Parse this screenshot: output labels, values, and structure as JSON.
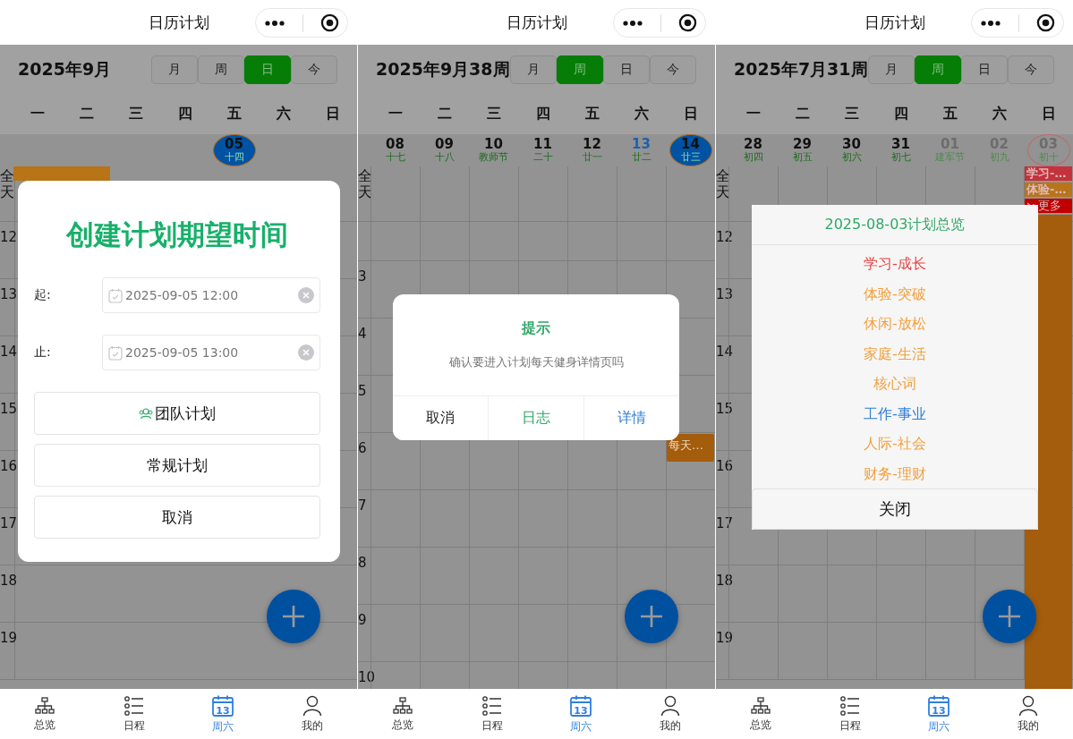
{
  "panels": [
    {
      "title": "日历计划",
      "heading": "2025年9月",
      "view_tabs": [
        {
          "label": "月",
          "selected": false
        },
        {
          "label": "周",
          "selected": false
        },
        {
          "label": "日",
          "selected": true
        },
        {
          "label": "今",
          "selected": false
        }
      ],
      "weekdays": [
        "一",
        "二",
        "三",
        "四",
        "五",
        "六",
        "日"
      ],
      "dates": [
        {
          "kind": "blank",
          "all_day": [
            {
              "kind": "wide",
              "color": "#b87416"
            }
          ]
        },
        {
          "kind": "blank"
        },
        {
          "kind": "blank"
        },
        {
          "kind": "blank"
        },
        {
          "day": "05",
          "lunar": "十四",
          "kind": "today"
        },
        {
          "kind": "blank"
        },
        {
          "kind": "blank"
        }
      ],
      "all_day_label": "全天",
      "hours": [
        {
          "kind": "hour",
          "label": "12"
        },
        {
          "kind": "hour",
          "label": "13"
        },
        {
          "kind": "hour",
          "label": "14"
        },
        {
          "kind": "hour",
          "label": "15"
        },
        {
          "kind": "hour",
          "label": "16"
        },
        {
          "kind": "hour",
          "label": "17"
        },
        {
          "kind": "hour",
          "label": "18"
        },
        {
          "kind": "hour",
          "label": "19"
        }
      ],
      "dialog": {
        "kind": "form",
        "title": "创建计划期望时间",
        "fields": [
          {
            "label": "起:",
            "value": "2025-09-05 12:00"
          },
          {
            "label": "止:",
            "value": "2025-09-05 13:00"
          }
        ],
        "buttons": [
          {
            "label": "团队计划",
            "icon": true
          },
          {
            "label": "常规计划",
            "icon": false
          },
          {
            "label": "取消",
            "icon": false
          }
        ]
      },
      "tabs": [
        {
          "label": "总览",
          "selected": false
        },
        {
          "label": "日程",
          "selected": false
        },
        {
          "label": "周六",
          "badge": "13",
          "selected": true
        },
        {
          "label": "我的",
          "selected": false
        }
      ]
    },
    {
      "title": "日历计划",
      "heading": "2025年9月38周",
      "view_tabs": [
        {
          "label": "月",
          "selected": false
        },
        {
          "label": "周",
          "selected": true
        },
        {
          "label": "日",
          "selected": false
        },
        {
          "label": "今",
          "selected": false
        }
      ],
      "weekdays": [
        "一",
        "二",
        "三",
        "四",
        "五",
        "六",
        "日"
      ],
      "dates": [
        {
          "day": "08",
          "lunar": "十七",
          "kind": "normal"
        },
        {
          "day": "09",
          "lunar": "十八",
          "kind": "normal"
        },
        {
          "day": "10",
          "lunar": "教师节",
          "kind": "normal"
        },
        {
          "day": "11",
          "lunar": "二十",
          "kind": "normal"
        },
        {
          "day": "12",
          "lunar": "廿一",
          "kind": "normal"
        },
        {
          "day": "13",
          "lunar": "廿二",
          "kind": "current"
        },
        {
          "day": "14",
          "lunar": "廿三",
          "kind": "today"
        }
      ],
      "all_day_label": "全天",
      "hours": [
        {
          "kind": "clipped"
        },
        {
          "kind": "hour",
          "label": "3"
        },
        {
          "kind": "hour",
          "label": "4"
        },
        {
          "kind": "hour",
          "label": "5"
        },
        {
          "kind": "hour",
          "label": "6",
          "cells": [
            {
              "kind": "empty"
            },
            {
              "kind": "empty"
            },
            {
              "kind": "empty"
            },
            {
              "kind": "empty"
            },
            {
              "kind": "empty"
            },
            {
              "kind": "empty"
            },
            {
              "kind": "event",
              "label": "每天…",
              "color": "#a45c0d"
            }
          ]
        },
        {
          "kind": "hour",
          "label": "7"
        },
        {
          "kind": "hour",
          "label": "8"
        },
        {
          "kind": "hour",
          "label": "9"
        },
        {
          "kind": "hour",
          "label": "10"
        }
      ],
      "dialog": {
        "kind": "confirm",
        "title": "提示",
        "message": "确认要进入计划每天健身详情页吗",
        "buttons": [
          {
            "label": "取消",
            "color": "#222222"
          },
          {
            "label": "日志",
            "color": "#2fa866"
          },
          {
            "label": "详情",
            "color": "#2f7fd6"
          }
        ]
      },
      "tabs": [
        {
          "label": "总览",
          "selected": false
        },
        {
          "label": "日程",
          "selected": false
        },
        {
          "label": "周六",
          "badge": "13",
          "selected": true
        },
        {
          "label": "我的",
          "selected": false
        }
      ]
    },
    {
      "title": "日历计划",
      "heading": "2025年7月31周",
      "view_tabs": [
        {
          "label": "月",
          "selected": false
        },
        {
          "label": "周",
          "selected": true
        },
        {
          "label": "日",
          "selected": false
        },
        {
          "label": "今",
          "selected": false
        }
      ],
      "weekdays": [
        "一",
        "二",
        "三",
        "四",
        "五",
        "六",
        "日"
      ],
      "dates": [
        {
          "day": "28",
          "lunar": "初四",
          "kind": "normal"
        },
        {
          "day": "29",
          "lunar": "初五",
          "kind": "normal"
        },
        {
          "day": "30",
          "lunar": "初六",
          "kind": "normal"
        },
        {
          "day": "31",
          "lunar": "初七",
          "kind": "normal"
        },
        {
          "day": "01",
          "lunar": "建军节",
          "kind": "other"
        },
        {
          "day": "02",
          "lunar": "初九",
          "kind": "other"
        },
        {
          "day": "03",
          "lunar": "初十",
          "kind": "ring",
          "all_day": [
            {
              "kind": "chip",
              "label": "学习-…",
              "color": "#c4323c"
            },
            {
              "kind": "chip",
              "label": "体验-…",
              "color": "#b8741a"
            },
            {
              "kind": "more",
              "label": "更多",
              "color": "#c00000"
            },
            {
              "kind": "bar",
              "color": "#a45c0d"
            }
          ]
        }
      ],
      "all_day_label": "全天",
      "hours": [
        {
          "kind": "hour",
          "label": "12"
        },
        {
          "kind": "hour",
          "label": "13"
        },
        {
          "kind": "hour",
          "label": "14"
        },
        {
          "kind": "hour",
          "label": "15"
        },
        {
          "kind": "hour",
          "label": "16"
        },
        {
          "kind": "hour",
          "label": "17"
        },
        {
          "kind": "hour",
          "label": "18"
        },
        {
          "kind": "hour",
          "label": "19"
        }
      ],
      "dialog": {
        "kind": "overview",
        "title": "2025-08-03计划总览",
        "items": [
          {
            "label": "学习-成长",
            "color": "#e64340"
          },
          {
            "label": "体验-突破",
            "color": "#f2a03d"
          },
          {
            "label": "休闲-放松",
            "color": "#f2a03d"
          },
          {
            "label": "家庭-生活",
            "color": "#f2a03d"
          },
          {
            "label": "核心词",
            "color": "#f2a03d"
          },
          {
            "label": "工作-事业",
            "color": "#2f7fd6"
          },
          {
            "label": "人际-社会",
            "color": "#f2a03d"
          },
          {
            "label": "财务-理财",
            "color": "#f2a03d"
          }
        ],
        "close": "关闭"
      },
      "tabs": [
        {
          "label": "总览",
          "selected": false
        },
        {
          "label": "日程",
          "selected": false
        },
        {
          "label": "周六",
          "badge": "13",
          "selected": true
        },
        {
          "label": "我的",
          "selected": false
        }
      ]
    }
  ]
}
